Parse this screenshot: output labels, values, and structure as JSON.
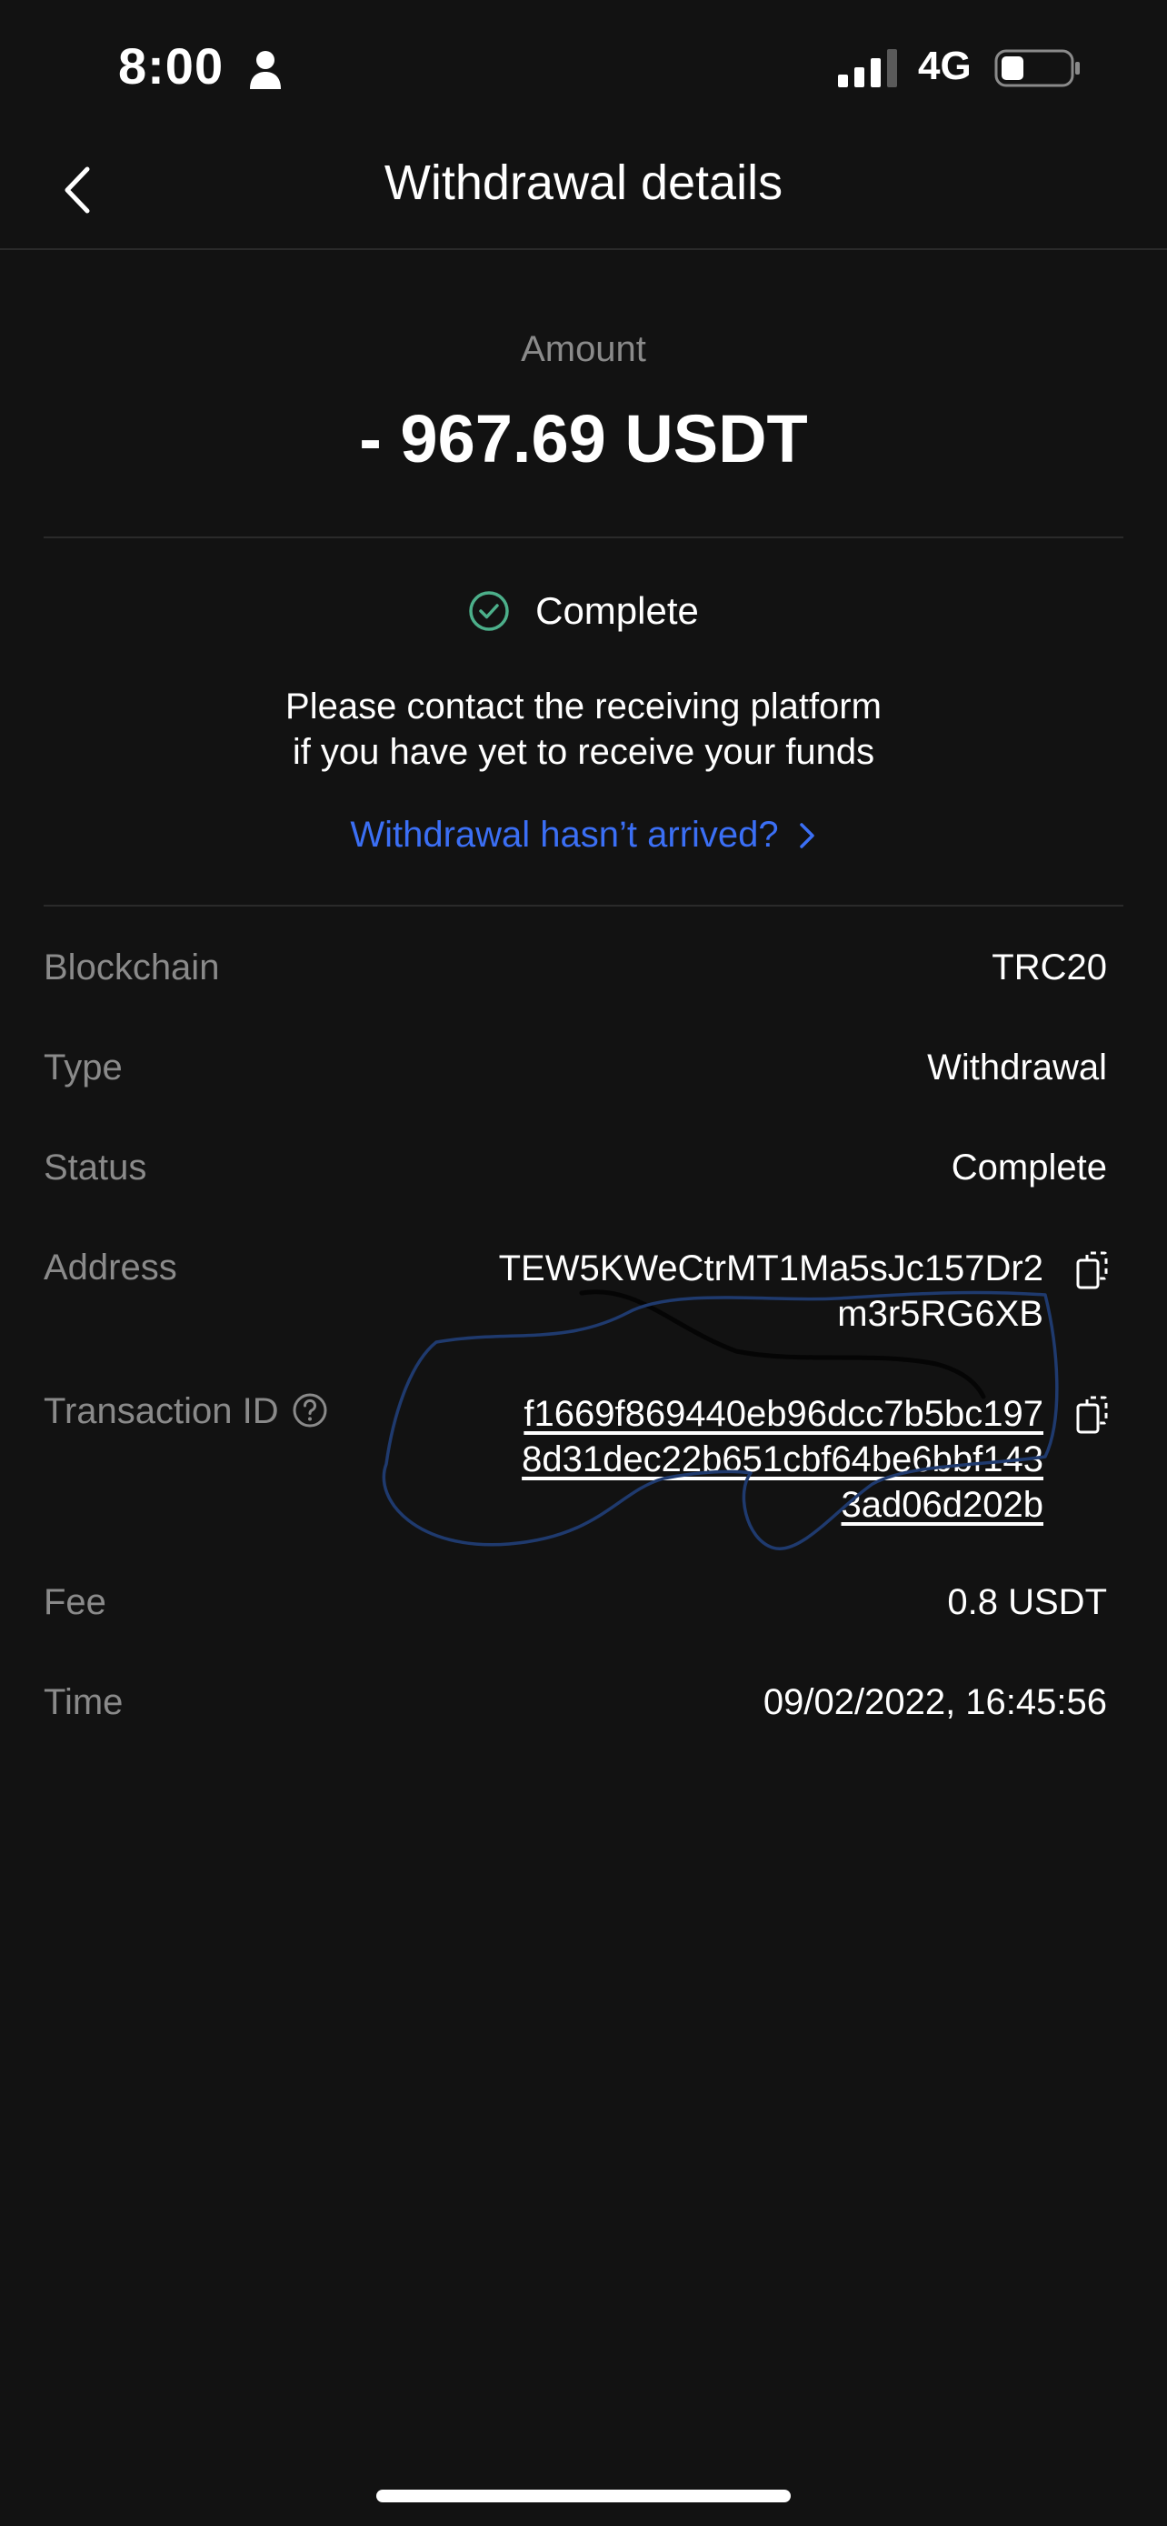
{
  "status_bar": {
    "time": "8:00",
    "network": "4G",
    "icons": [
      "person-icon",
      "signal-icon",
      "battery-icon"
    ]
  },
  "header": {
    "title": "Withdrawal details",
    "back_icon": "chevron-left-icon"
  },
  "amount": {
    "label": "Amount",
    "value": "- 967.69 USDT"
  },
  "status": {
    "text": "Complete",
    "icon": "check-circle-icon",
    "color": "#4caf8a"
  },
  "notice": {
    "line1": "Please contact the receiving platform",
    "line2": "if you have yet to receive your funds"
  },
  "help_link": {
    "label": "Withdrawal hasn’t arrived?",
    "color": "#3b6ff5"
  },
  "details": {
    "blockchain": {
      "label": "Blockchain",
      "value": "TRC20"
    },
    "type": {
      "label": "Type",
      "value": "Withdrawal"
    },
    "status": {
      "label": "Status",
      "value": "Complete"
    },
    "address": {
      "label": "Address",
      "line1": "TEW5KWeCtrMT1Ma5sJc157Dr2",
      "line2": "m3r5RG6XB"
    },
    "txid": {
      "label": "Transaction ID",
      "line1": "f1669f869440eb96dcc7b5bc197",
      "line2": "8d31dec22b651cbf64be6bbf143",
      "line3": "3ad06d202b"
    },
    "fee": {
      "label": "Fee",
      "value": "0.8 USDT"
    },
    "time": {
      "label": "Time",
      "value": "09/02/2022, 16:45:56"
    }
  }
}
